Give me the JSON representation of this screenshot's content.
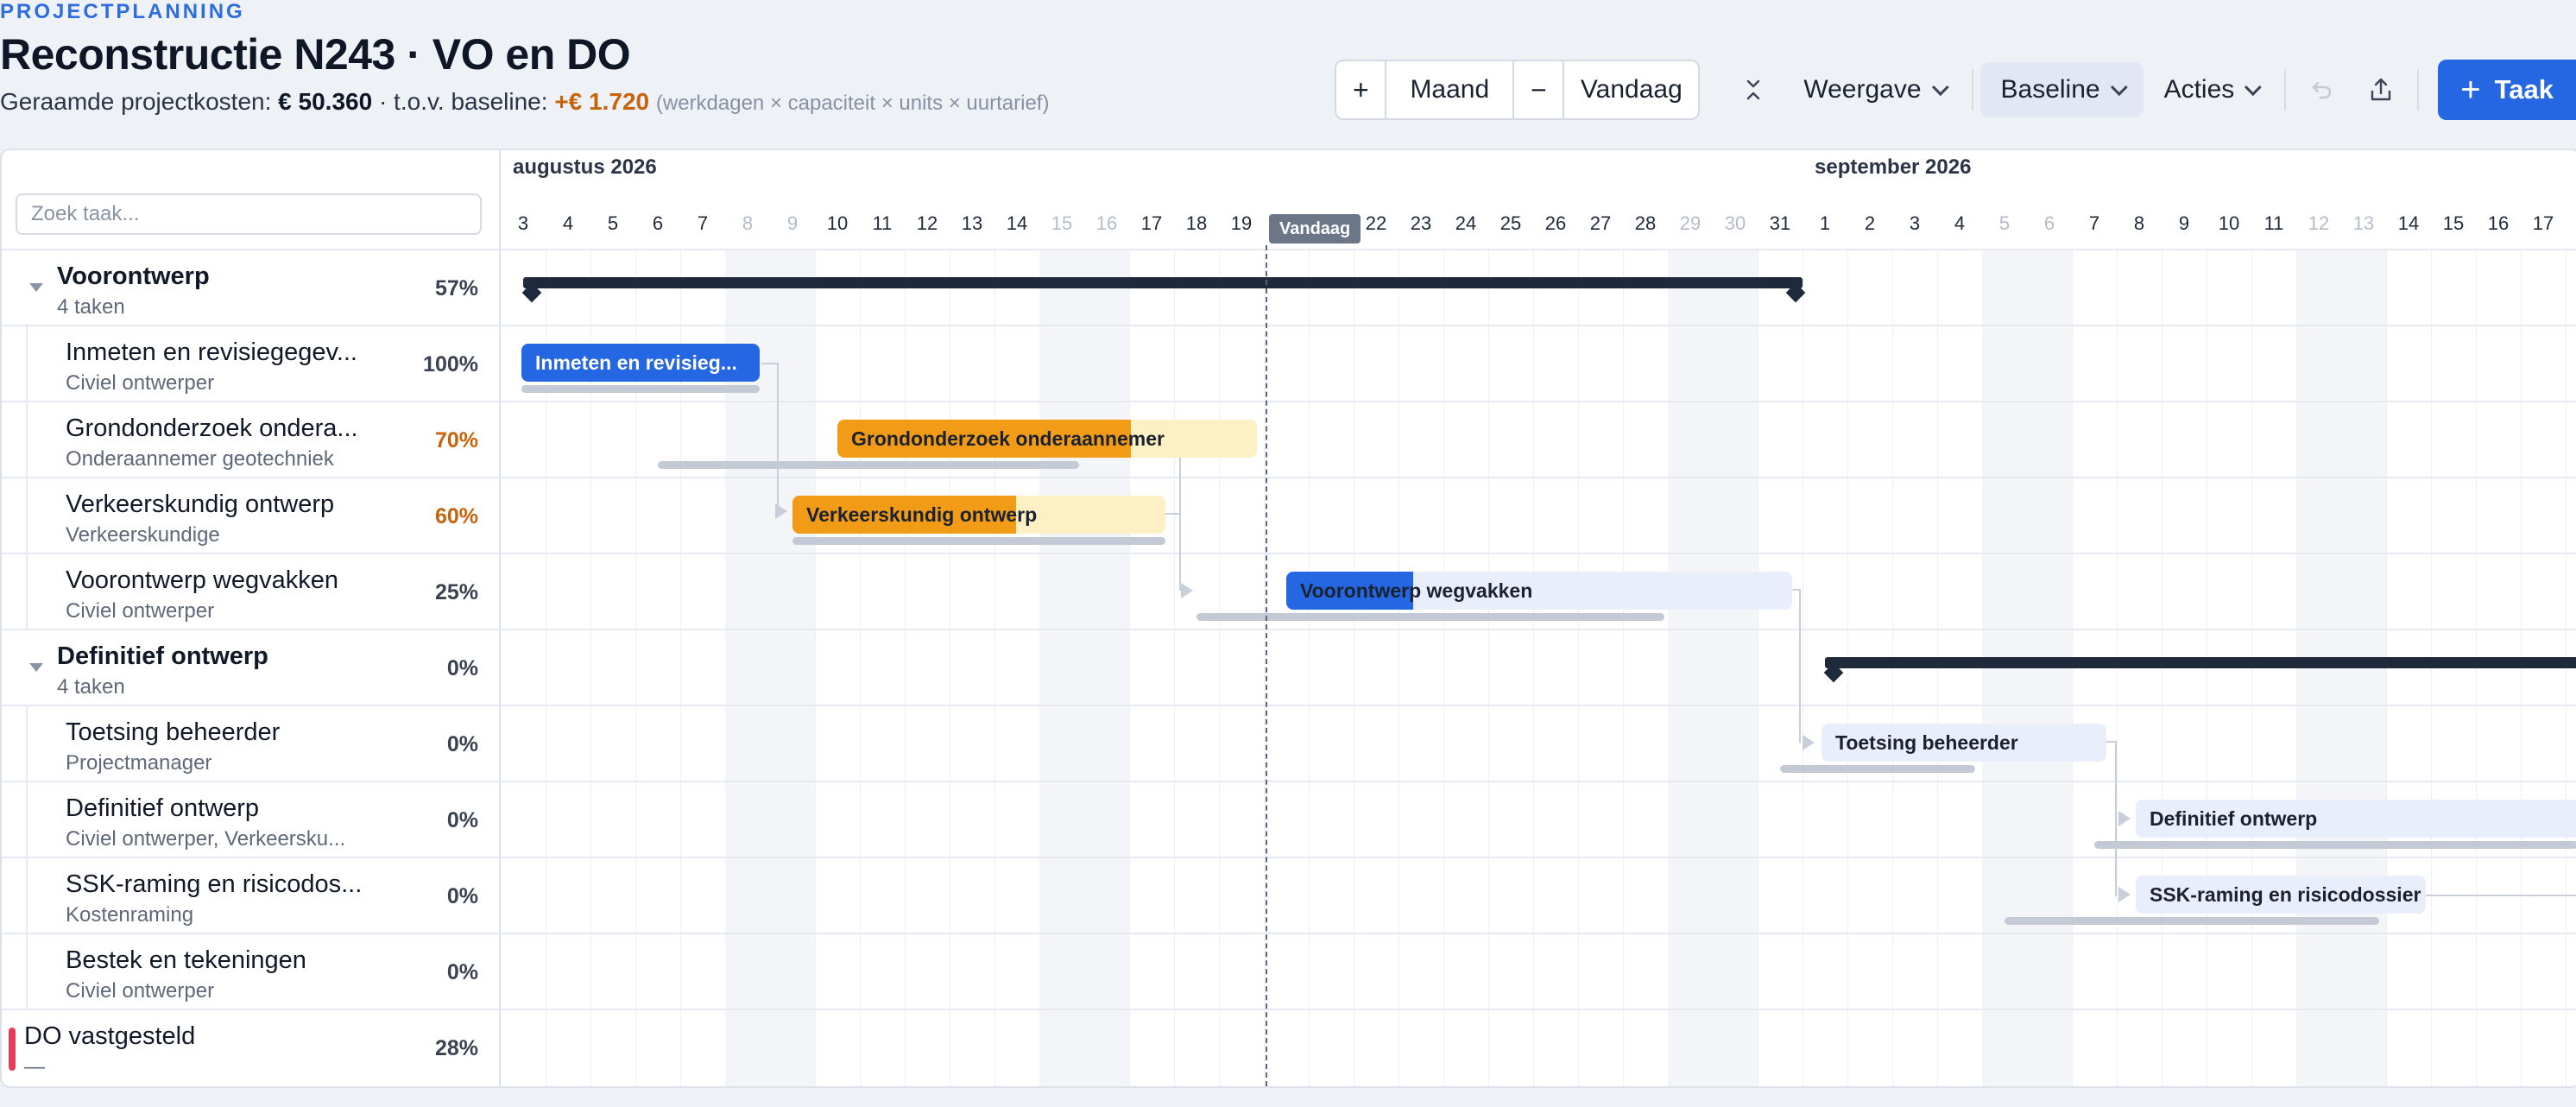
{
  "header": {
    "eyebrow": "PROJECTPLANNING",
    "title": "Reconstructie N243 · VO en DO",
    "cost_label": "Geraamde projectkosten:",
    "cost_value": "€ 50.360",
    "baseline_label": "· t.o.v. baseline:",
    "baseline_delta": "+€ 1.720",
    "formula": "(werkdagen × capaciteit × units × uurtarief)"
  },
  "toolbar": {
    "zoom_in": "+",
    "scale": "Maand",
    "zoom_out": "−",
    "today": "Vandaag",
    "view": "Weergave",
    "baseline": "Baseline",
    "actions": "Acties",
    "add_task": "Taak"
  },
  "search": {
    "placeholder": "Zoek taak..."
  },
  "timeline": {
    "months": [
      "augustus 2026",
      "september 2026"
    ],
    "days": [
      "3",
      "4",
      "5",
      "6",
      "7",
      "8",
      "9",
      "10",
      "11",
      "12",
      "13",
      "14",
      "15",
      "16",
      "17",
      "18",
      "19",
      "20",
      "21",
      "22",
      "23",
      "24",
      "25",
      "26",
      "27",
      "28",
      "29",
      "30",
      "31",
      "1",
      "2",
      "3",
      "4",
      "5",
      "6",
      "7",
      "8",
      "9",
      "10",
      "11",
      "12",
      "13",
      "14",
      "15",
      "16",
      "17"
    ],
    "weekend_days": [
      "8",
      "9",
      "15",
      "16",
      "29",
      "30",
      "5",
      "6",
      "12",
      "13"
    ],
    "today_label": "Vandaag"
  },
  "rows": [
    {
      "type": "group",
      "name": "Voorontwerp",
      "sub": "4 taken",
      "pct": "57%"
    },
    {
      "type": "task",
      "name": "Inmeten en revisiegegev...",
      "sub": "Civiel ontwerper",
      "pct": "100%",
      "bar_label": "Inmeten en revisieg...",
      "progress": 1.0
    },
    {
      "type": "task",
      "name": "Grondonderzoek ondera...",
      "sub": "Onderaannemer geotechniek",
      "pct": "70%",
      "bar_label": "Grondonderzoek onderaannemer",
      "progress": 0.7
    },
    {
      "type": "task",
      "name": "Verkeerskundig ontwerp",
      "sub": "Verkeerskundige",
      "pct": "60%",
      "bar_label": "Verkeerskundig ontwerp",
      "progress": 0.6
    },
    {
      "type": "task",
      "name": "Voorontwerp wegvakken",
      "sub": "Civiel ontwerper",
      "pct": "25%",
      "bar_label": "Voorontwerp wegvakken",
      "progress": 0.25
    },
    {
      "type": "group",
      "name": "Definitief ontwerp",
      "sub": "4 taken",
      "pct": "0%"
    },
    {
      "type": "task",
      "name": "Toetsing beheerder",
      "sub": "Projectmanager",
      "pct": "0%",
      "bar_label": "Toetsing beheerder",
      "progress": 0
    },
    {
      "type": "task",
      "name": "Definitief ontwerp",
      "sub": "Civiel ontwerper, Verkeersku...",
      "pct": "0%",
      "bar_label": "Definitief ontwerp",
      "progress": 0
    },
    {
      "type": "task",
      "name": "SSK-raming en risicodos...",
      "sub": "Kostenraming",
      "pct": "0%",
      "bar_label": "SSK-raming en risicodossier",
      "progress": 0
    },
    {
      "type": "task",
      "name": "Bestek en tekeningen",
      "sub": "Civiel ontwerper",
      "pct": "0%"
    },
    {
      "type": "milestone",
      "name": "DO vastgesteld",
      "sub": "—",
      "pct": "28%"
    }
  ],
  "colors": {
    "accent": "#2567e3",
    "warning": "#f29b16",
    "milestone": "#e13e5a",
    "summary": "#1e293b"
  }
}
